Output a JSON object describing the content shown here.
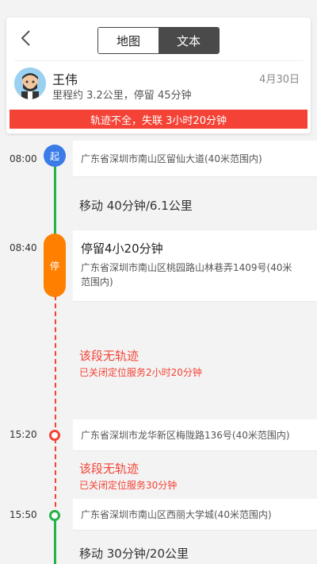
{
  "header": {
    "segments": [
      {
        "label": "地图"
      },
      {
        "label": "文本"
      }
    ],
    "user": {
      "name": "王伟",
      "date": "4月30日",
      "summary": "里程约 3.2公里，停留 45分钟"
    },
    "warning": "轨迹不全，失联 3小时20分钟"
  },
  "timeline": {
    "start": {
      "time": "08:00",
      "badge": "起",
      "address": "广东省深圳市南山区留仙大道(40米范围内)"
    },
    "move1": {
      "text": "移动 40分钟/6.1公里"
    },
    "stop": {
      "time": "08:40",
      "badge": "停",
      "title": "停留4小20分钟",
      "address_line1": "广东省深圳市南山区桃园路山林巷弄1409号(40米",
      "address_line2": "范围内)"
    },
    "gap1": {
      "title": "该段无轨迹",
      "sub": "已关闭定位服务2小时20分钟"
    },
    "point1": {
      "time": "15:20",
      "address": "广东省深圳市龙华新区梅陇路136号(40米范围内)"
    },
    "gap2": {
      "title": "该段无轨迹",
      "sub": "已关闭定位服务30分钟"
    },
    "point2": {
      "time": "15:50",
      "address": "广东省深圳市南山区西丽大学城(40米范围内)"
    },
    "move2": {
      "text": "移动 30分钟/20公里"
    }
  },
  "colors": {
    "accent_red": "#f44336",
    "green": "#26b24a",
    "blue": "#3a7be8",
    "orange": "#ff7f00"
  },
  "icons": {
    "back": "chevron-left-icon",
    "avatar": "user-avatar"
  }
}
